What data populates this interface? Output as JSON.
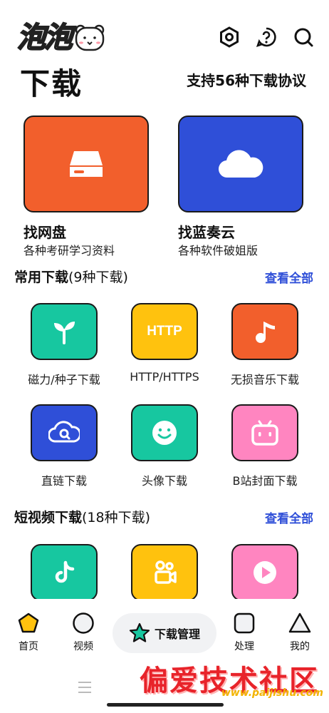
{
  "brand": {
    "logo_text": "泡泡"
  },
  "header": {
    "title": "下载",
    "protocol_text": "支持56种下载协议"
  },
  "top_icons": [
    "settings-hex-icon",
    "help-icon",
    "search-icon"
  ],
  "cards": [
    {
      "title": "找网盘",
      "subtitle": "各种考研学习资料",
      "icon": "drive-icon",
      "color": "#F25F2C"
    },
    {
      "title": "找蓝奏云",
      "subtitle": "各种软件破姐版",
      "icon": "cloud-icon",
      "color": "#2F4FD8"
    }
  ],
  "section_common": {
    "title": "常用下载",
    "count": "(9种下载)",
    "see_all": "查看全部",
    "items": [
      {
        "label": "磁力/种子下载",
        "icon": "sprout-icon",
        "color": "#17C7A0"
      },
      {
        "label": "HTTP/HTTPS",
        "icon": "http-icon",
        "icon_text": "HTTP",
        "color": "#FFC20E"
      },
      {
        "label": "无损音乐下载",
        "icon": "music-note-icon",
        "color": "#F25F2C"
      },
      {
        "label": "直链下载",
        "icon": "cloud-search-icon",
        "color": "#2F4FD8"
      },
      {
        "label": "头像下载",
        "icon": "smiley-icon",
        "color": "#17C7A0"
      },
      {
        "label": "B站封面下载",
        "icon": "bilibili-icon",
        "color": "#FF85C0"
      }
    ]
  },
  "section_video": {
    "title": "短视频下载",
    "count": "(18种下载)",
    "see_all": "查看全部",
    "items": [
      {
        "icon": "tiktok-icon",
        "color": "#17C7A0"
      },
      {
        "icon": "kuaishou-icon",
        "color": "#FFC20E"
      },
      {
        "icon": "play-icon",
        "color": "#FF85C0"
      }
    ]
  },
  "bottom_nav": {
    "items": [
      {
        "label": "首页",
        "icon": "home-pentagon-icon",
        "active": true
      },
      {
        "label": "视频",
        "icon": "circle-icon"
      },
      {
        "label": "处理",
        "icon": "square-icon"
      },
      {
        "label": "我的",
        "icon": "triangle-icon"
      }
    ],
    "center_label": "下载管理",
    "center_icon": "star-icon"
  },
  "watermark": {
    "text": "偏爱技术社区",
    "url": "www.paijishu.com"
  },
  "colors": {
    "accent_blue": "#2F4FD8",
    "active_yellow": "#FFC20E"
  }
}
